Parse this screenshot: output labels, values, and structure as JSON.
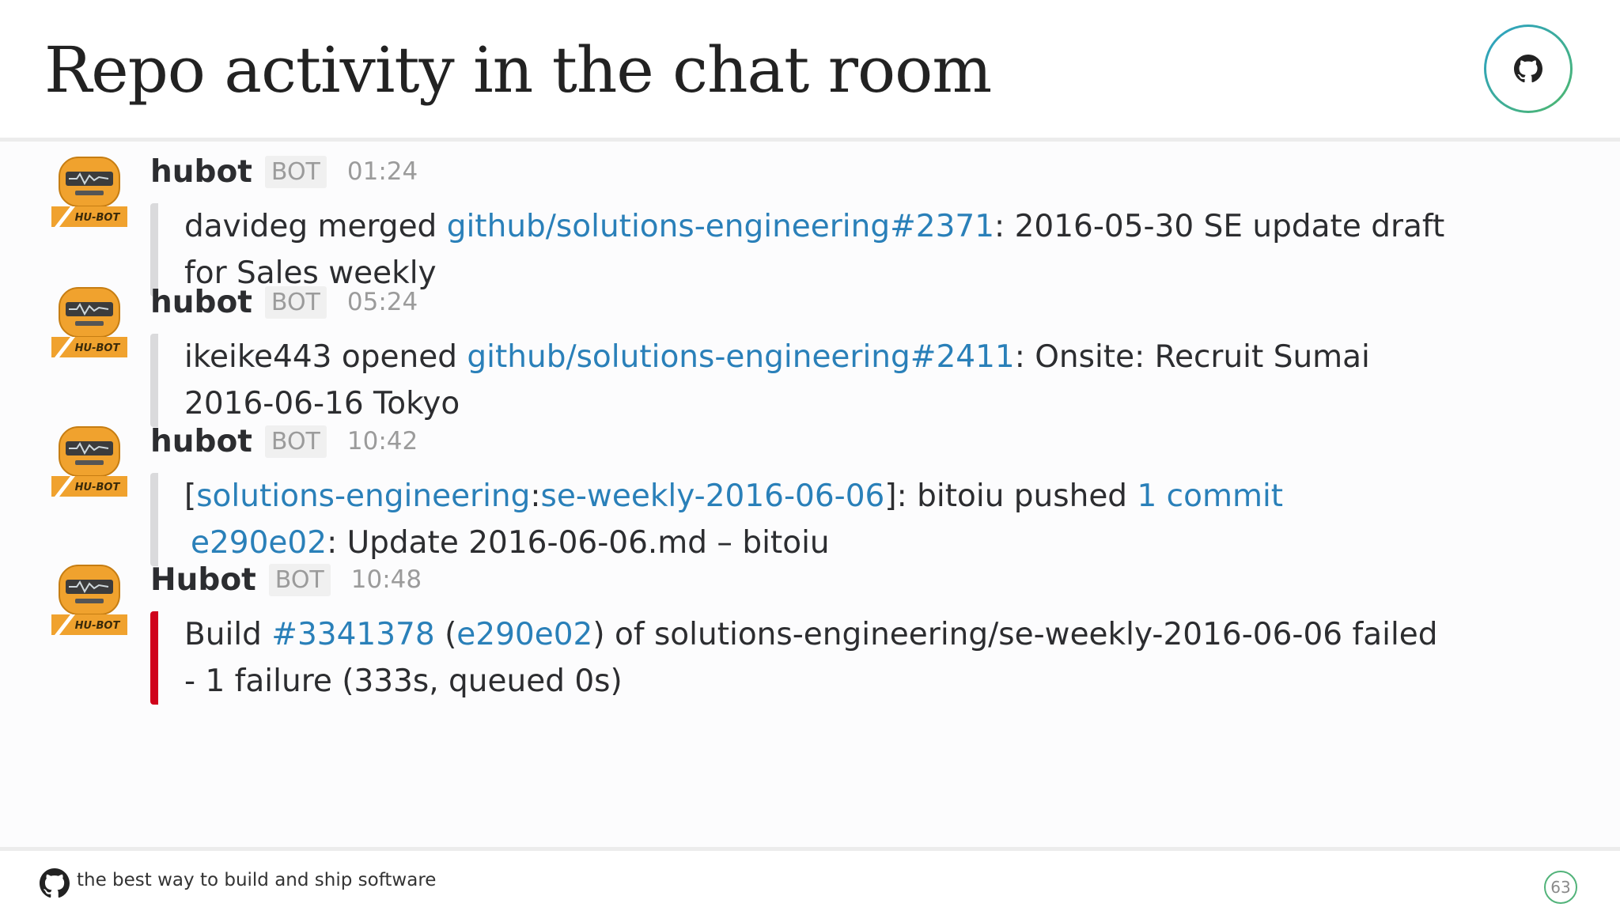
{
  "slide": {
    "title": "Repo activity in the chat room",
    "page_number": "63"
  },
  "footer": {
    "tagline": "the best way to build and ship software"
  },
  "messages": [
    {
      "author": "hubot",
      "badge": "BOT",
      "time": "01:24",
      "avatar_label": "HU-BOT",
      "parts": [
        {
          "text": "davideg merged ",
          "link": false
        },
        {
          "text": "github/solutions-engineering#2371",
          "link": true
        },
        {
          "text": ": 2016-05-30 SE update draft for Sales weekly",
          "link": false
        }
      ]
    },
    {
      "author": "hubot",
      "badge": "BOT",
      "time": "05:24",
      "avatar_label": "HU-BOT",
      "parts": [
        {
          "text": "ikeike443 opened ",
          "link": false
        },
        {
          "text": "github/solutions-engineering#2411",
          "link": true
        },
        {
          "text": ": Onsite: Recruit Sumai 2016-06-16 Tokyo",
          "link": false
        }
      ]
    },
    {
      "author": "hubot",
      "badge": "BOT",
      "time": "10:42",
      "avatar_label": "HU-BOT",
      "parts": [
        {
          "text": "[",
          "link": false
        },
        {
          "text": "solutions-engineering",
          "link": true
        },
        {
          "text": ":",
          "link": false
        },
        {
          "text": "se-weekly-2016-06-06",
          "link": true
        },
        {
          "text": "]: bitoiu pushed ",
          "link": false
        },
        {
          "text": "1 commit",
          "link": true
        },
        {
          "text": "e290e02",
          "link": true
        },
        {
          "text": ": Update 2016-06-06.md – bitoiu",
          "link": false
        }
      ]
    },
    {
      "author": "Hubot",
      "badge": "BOT",
      "time": "10:48",
      "avatar_label": "HU-BOT",
      "parts": [
        {
          "text": "Build ",
          "link": false
        },
        {
          "text": "#3341378",
          "link": true
        },
        {
          "text": " (",
          "link": false
        },
        {
          "text": "e290e02",
          "link": true
        },
        {
          "text": ") of solutions-engineering/se-weekly-2016-06-06 failed - 1 failure (333s, queued 0s)",
          "link": false
        }
      ]
    }
  ],
  "colors": {
    "link": "#2a80b9",
    "failure_bar": "#d0021b",
    "neutral_bar": "#dadadc",
    "avatar": "#f0a22e"
  }
}
